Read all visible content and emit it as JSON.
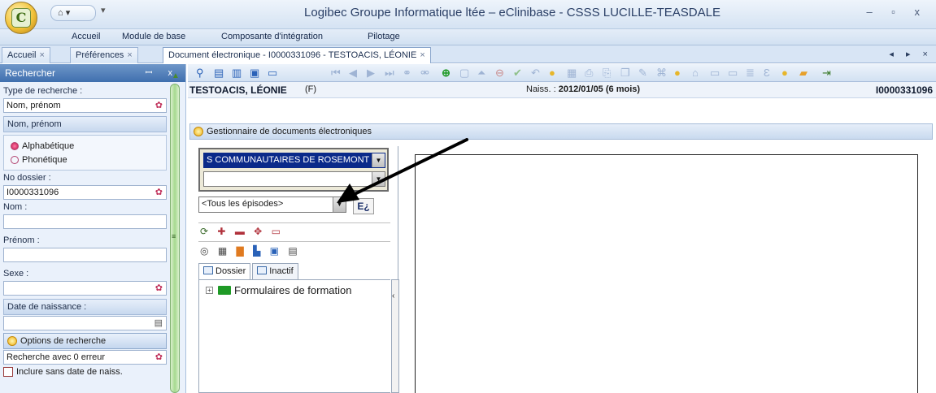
{
  "app": {
    "window_title": "Logibec Groupe Informatique ltée – eClinibase - CSSS LUCILLE-TEASDALE",
    "logo_letter": "C",
    "qat_label": "⌂ ▾",
    "window_controls": "– ▫ x"
  },
  "menu": [
    "Accueil",
    "Module de base",
    "Composante d'intégration",
    "Pilotage"
  ],
  "doc_tabs": [
    {
      "label": "Accueil",
      "close": "×"
    },
    {
      "label": "Préférences",
      "close": "×"
    },
    {
      "label": "Document électronique - I0000331096 - TESTOACIS, LÉONIE",
      "close": "×"
    }
  ],
  "tab_scroll": "◂ ▸ ×",
  "search_panel": {
    "title": "Rechercher",
    "pin": "ꟷ x",
    "type_label": "Type de recherche :",
    "type_value": "Nom, prénom",
    "section_nom": "Nom, prénom",
    "radio_alpha": "Alphabétique",
    "radio_phon": "Phonétique",
    "dossier_label": "No dossier :",
    "dossier_value": "I0000331096",
    "nom_label": "Nom :",
    "prenom_label": "Prénom :",
    "sexe_label": "Sexe :",
    "naissance_label": "Date de naissance :",
    "options_label": "Options de recherche",
    "erreur_value": "Recherche avec 0 erreur",
    "inclure_label": "Inclure sans date de naiss."
  },
  "patient": {
    "name": "TESTOACIS, LÉONIE",
    "sex": "(F)",
    "naiss_label": "Naiss. :",
    "naiss_value": "2012/01/05 (6 mois)",
    "number": "I0000331096"
  },
  "gestionnaire": {
    "title": "Gestionnaire de documents électroniques",
    "org_combo": "S COMMUNAUTAIRES DE ROSEMONT",
    "episodes_combo": "<Tous les épisodes>",
    "ea_button": "E¿",
    "tab_dossier": "Dossier",
    "tab_inactif": "Inactif",
    "tree_item": "Formulaires de formation"
  },
  "colors": {
    "accent": "#3f6fae",
    "selection": "#0a2a8a",
    "folder": "#1f9a26"
  }
}
